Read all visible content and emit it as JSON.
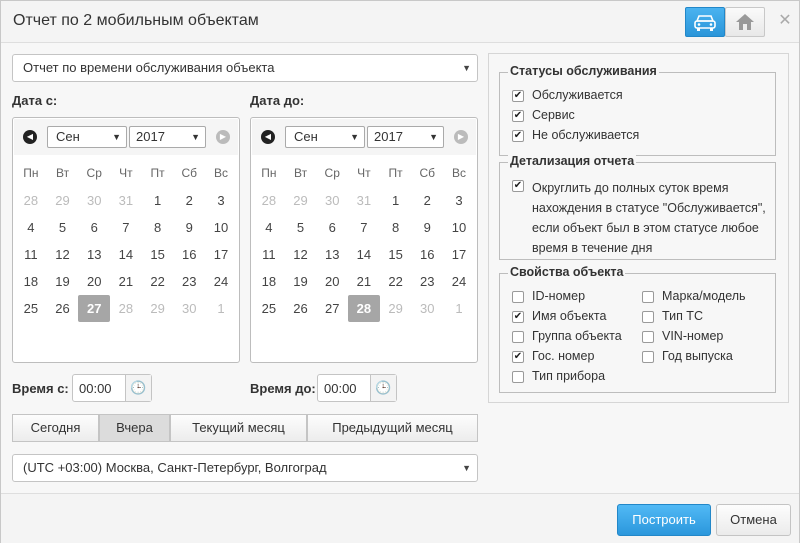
{
  "header": {
    "title": "Отчет по 2 мобильным объектам"
  },
  "report_type": {
    "value": "Отчет по времени обслуживания объекта"
  },
  "date_from": {
    "label": "Дата с:",
    "month": "Сен",
    "year": "2017",
    "weekdays": [
      "Пн",
      "Вт",
      "Ср",
      "Чт",
      "Пт",
      "Сб",
      "Вс"
    ],
    "weeks": [
      [
        "28",
        "29",
        "30",
        "31",
        "1",
        "2",
        "3"
      ],
      [
        "4",
        "5",
        "6",
        "7",
        "8",
        "9",
        "10"
      ],
      [
        "11",
        "12",
        "13",
        "14",
        "15",
        "16",
        "17"
      ],
      [
        "18",
        "19",
        "20",
        "21",
        "22",
        "23",
        "24"
      ],
      [
        "25",
        "26",
        "27",
        "28",
        "29",
        "30",
        "1"
      ]
    ],
    "selected": "27"
  },
  "date_to": {
    "label": "Дата до:",
    "month": "Сен",
    "year": "2017",
    "weekdays": [
      "Пн",
      "Вт",
      "Ср",
      "Чт",
      "Пт",
      "Сб",
      "Вс"
    ],
    "weeks": [
      [
        "28",
        "29",
        "30",
        "31",
        "1",
        "2",
        "3"
      ],
      [
        "4",
        "5",
        "6",
        "7",
        "8",
        "9",
        "10"
      ],
      [
        "11",
        "12",
        "13",
        "14",
        "15",
        "16",
        "17"
      ],
      [
        "18",
        "19",
        "20",
        "21",
        "22",
        "23",
        "24"
      ],
      [
        "25",
        "26",
        "27",
        "28",
        "29",
        "30",
        "1"
      ]
    ],
    "selected": "28"
  },
  "time_from": {
    "label": "Время с:",
    "value": "00:00"
  },
  "time_to": {
    "label": "Время до:",
    "value": "00:00"
  },
  "quick_ranges": [
    "Сегодня",
    "Вчера",
    "Текущий месяц",
    "Предыдущий месяц"
  ],
  "quick_active": "Вчера",
  "timezone": {
    "value": "(UTC +03:00) Москва, Санкт-Петербург, Волгоград"
  },
  "statuses": {
    "legend": "Статусы обслуживания",
    "items": [
      {
        "label": "Обслуживается",
        "checked": true
      },
      {
        "label": "Сервис",
        "checked": true
      },
      {
        "label": "Не обслуживается",
        "checked": true
      }
    ]
  },
  "detail": {
    "legend": "Детализация отчета",
    "lines": [
      "Округлить до полных суток время",
      "нахождения в статусе \"Обслуживается\",",
      "если объект был в этом статусе любое",
      "время в течение дня"
    ],
    "checked": true
  },
  "props": {
    "legend": "Свойства объекта",
    "left": [
      {
        "label": "ID-номер",
        "checked": false
      },
      {
        "label": "Имя объекта",
        "checked": true
      },
      {
        "label": "Группа объекта",
        "checked": false
      },
      {
        "label": "Гос. номер",
        "checked": true
      },
      {
        "label": "Тип прибора",
        "checked": false
      }
    ],
    "right": [
      {
        "label": "Марка/модель",
        "checked": false
      },
      {
        "label": "Тип ТС",
        "checked": false
      },
      {
        "label": "VIN-номер",
        "checked": false
      },
      {
        "label": "Год выпуска",
        "checked": false
      }
    ]
  },
  "footer": {
    "build_label": "Построить",
    "cancel_label": "Отмена"
  },
  "colors": {
    "accent": "#2b97dc",
    "selected_day": "#a6a6a6"
  },
  "icons": {
    "car": "car-icon",
    "home": "home-icon",
    "close": "close-icon",
    "clock": "clock-icon"
  }
}
